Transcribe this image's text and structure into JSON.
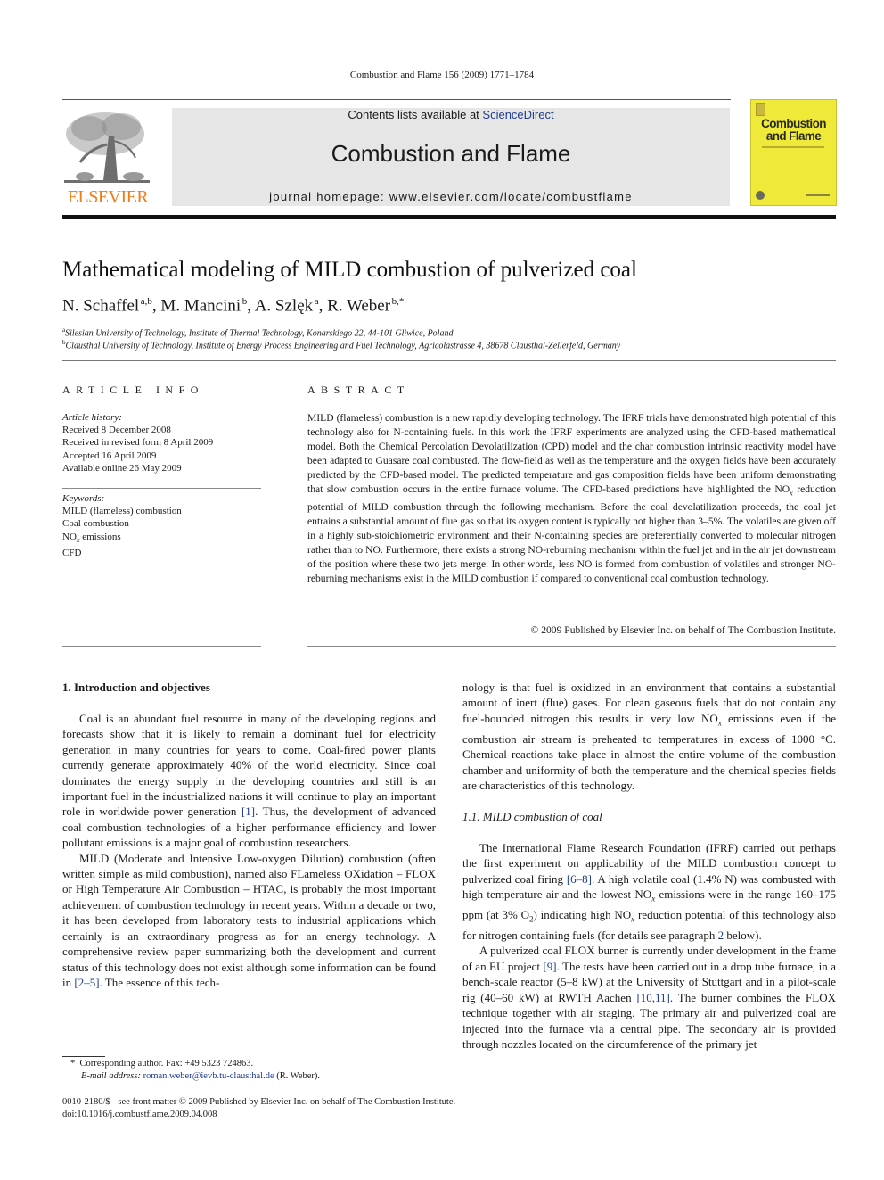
{
  "running_head": "Combustion and Flame 156 (2009) 1771–1784",
  "banner": {
    "contents_prefix": "Contents lists available at ",
    "contents_link": "ScienceDirect",
    "journal_name": "Combustion and Flame",
    "homepage": "journal homepage: www.elsevier.com/locate/combustflame"
  },
  "publisher_logo": {
    "wordmark": "ELSEVIER",
    "color": "#f07d1a"
  },
  "cover": {
    "title_line1": "Combustion",
    "title_line2": "and Flame",
    "color": "#efe93a"
  },
  "article": {
    "title": "Mathematical modeling of MILD combustion of pulverized coal",
    "authors": [
      {
        "name": "N. Schaffel",
        "sup": "a,b",
        "sep": ", "
      },
      {
        "name": "M. Mancini",
        "sup": "b",
        "sep": ", "
      },
      {
        "name": "A. Szlęk",
        "sup": "a",
        "sep": ", "
      },
      {
        "name": "R. Weber",
        "sup": "b,*",
        "sep": ""
      }
    ],
    "affiliations": [
      {
        "sup": "a",
        "text": "Silesian University of Technology, Institute of Thermal Technology, Konarskiego 22, 44-101 Gliwice, Poland"
      },
      {
        "sup": "b",
        "text": "Clausthal University of Technology, Institute of Energy Process Engineering and Fuel Technology, Agricolastrasse 4, 38678 Clausthal-Zellerfeld, Germany"
      }
    ]
  },
  "article_info": {
    "heading": "ARTICLE INFO",
    "history_label": "Article history:",
    "history": [
      "Received 8 December 2008",
      "Received in revised form 8 April 2009",
      "Accepted 16 April 2009",
      "Available online 26 May 2009"
    ],
    "keywords_label": "Keywords:",
    "keywords": [
      {
        "text": "MILD (flameless) combustion",
        "sub": ""
      },
      {
        "text": "Coal combustion",
        "sub": ""
      },
      {
        "text": "NO",
        "sub": "x",
        "after": " emissions"
      },
      {
        "text": "CFD",
        "sub": ""
      }
    ]
  },
  "abstract": {
    "heading": "ABSTRACT",
    "text_part1": "MILD (flameless) combustion is a new rapidly developing technology. The IFRF trials have demonstrated high potential of this technology also for N-containing fuels. In this work the IFRF experiments are analyzed using the CFD-based mathematical model. Both the Chemical Percolation Devolatilization (CPD) model and the char combustion intrinsic reactivity model have been adapted to Guasare coal combusted. The flow-field as well as the temperature and the oxygen fields have been accurately predicted by the CFD-based model. The predicted temperature and gas composition fields have been uniform demonstrating that slow combustion occurs in the entire furnace volume. The CFD-based predictions have highlighted the NO",
    "text_sub": "x",
    "text_part2": " reduction potential of MILD combustion through the following mechanism. Before the coal devolatilization proceeds, the coal jet entrains a substantial amount of flue gas so that its oxygen content is typically not higher than 3–5%. The volatiles are given off in a highly sub-stoichiometric environment and their N-containing species are preferentially converted to molecular nitrogen rather than to NO. Furthermore, there exists a strong NO-reburning mechanism within the fuel jet and in the air jet downstream of the position where these two jets merge. In other words, less NO is formed from combustion of volatiles and stronger NO-reburning mechanisms exist in the MILD combustion if compared to conventional coal combustion technology.",
    "copyright": "© 2009 Published by Elsevier Inc. on behalf of The Combustion Institute."
  },
  "body": {
    "section1_heading": "1. Introduction and objectives",
    "p1_a": "Coal is an abundant fuel resource in many of the developing regions and forecasts show that it is likely to remain a dominant fuel for electricity generation in many countries for years to come. Coal-fired power plants currently generate approximately 40% of the world electricity. Since coal dominates the energy supply in the developing countries and still is an important fuel in the industrialized nations it will continue to play an important role in worldwide power generation ",
    "p1_ref": "[1]",
    "p1_b": ". Thus, the development of advanced coal combustion technologies of a higher performance efficiency and lower pollutant emissions is a major goal of combustion researchers.",
    "p2_a": "MILD (Moderate and Intensive Low-oxygen Dilution) combustion (often written simple as mild combustion), named also FLameless OXidation – FLOX or High Temperature Air Combustion – HTAC, is probably the most important achievement of combustion technology in recent years. Within a decade or two, it has been developed from laboratory tests to industrial applications which certainly is an extraordinary progress as for an energy technology. A comprehensive review paper summarizing both the development and current status of this technology does not exist although some information can be found in ",
    "p2_ref": "[2–5]",
    "p2_b": ". The essence of this tech-",
    "p3_a": "nology is that fuel is oxidized in an environment that contains a substantial amount of inert (flue) gases. For clean gaseous fuels that do not contain any fuel-bounded nitrogen this results in very low NO",
    "p3_sub": "x",
    "p3_b": " emissions even if the combustion air stream is preheated to temperatures in excess of 1000 °C. Chemical reactions take place in almost the entire volume of the combustion chamber and uniformity of both the temperature and the chemical species fields are characteristics of this technology.",
    "subsection_heading": "1.1. MILD combustion of coal",
    "p4_a": "The International Flame Research Foundation (IFRF) carried out perhaps the first experiment on applicability of the MILD combustion concept to pulverized coal firing ",
    "p4_ref": "[6–8]",
    "p4_b": ". A high volatile coal (1.4% N) was combusted with high temperature air and the lowest NO",
    "p4_sub1": "x",
    "p4_c": " emissions were in the range 160–175 ppm (at 3% O",
    "p4_sub2": "2",
    "p4_d": ") indicating high NO",
    "p4_sub3": "x",
    "p4_e": " reduction potential of this technology also for nitrogen containing fuels (for details see paragraph ",
    "p4_ref2": "2",
    "p4_f": " below).",
    "p5_a": "A pulverized coal FLOX burner is currently under development in the frame of an EU project ",
    "p5_ref": "[9]",
    "p5_b": ". The tests have been carried out in a drop tube furnace, in a bench-scale reactor (5–8 kW) at the University of Stuttgart and in a pilot-scale rig (40–60 kW) at RWTH Aachen ",
    "p5_ref2": "[10,11]",
    "p5_c": ". The burner combines the FLOX technique together with air staging. The primary air and pulverized coal are injected into the furnace via a central pipe. The secondary air is provided through nozzles located on the circumference of the primary jet"
  },
  "footnote": {
    "marker": "*",
    "corresponding": "Corresponding author. Fax: +49 5323 724863.",
    "email_label": "E-mail address: ",
    "email": "roman.weber@ievb.tu-clausthal.de",
    "email_after": " (R. Weber)."
  },
  "bottom": {
    "issn_line": "0010-2180/$ - see front matter © 2009 Published by Elsevier Inc. on behalf of The Combustion Institute.",
    "doi": "doi:10.1016/j.combustflame.2009.04.008"
  }
}
